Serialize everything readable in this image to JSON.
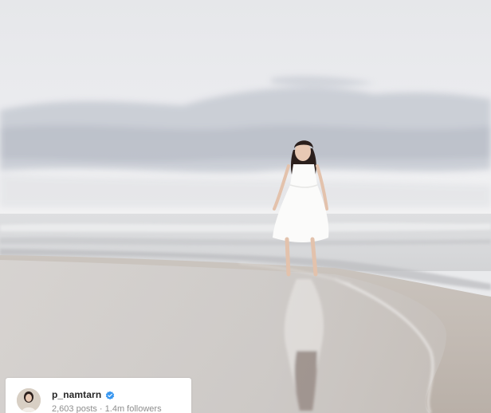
{
  "profile": {
    "username": "p_namtarn",
    "stats": "2,603 posts · 1.4m followers",
    "verified": true
  },
  "photo": {
    "subject": "beach-photo",
    "colors": {
      "sky": "#e8e9ec",
      "clouds": "#c4c9d2",
      "sea": "#d8dadc",
      "sand": "#b5aca4"
    }
  },
  "icons": {
    "verified": "verified-badge-icon"
  },
  "colors": {
    "card_bg": "#ffffff",
    "username": "#262626",
    "stats": "#8e8e8e",
    "verified": "#3897f0"
  }
}
